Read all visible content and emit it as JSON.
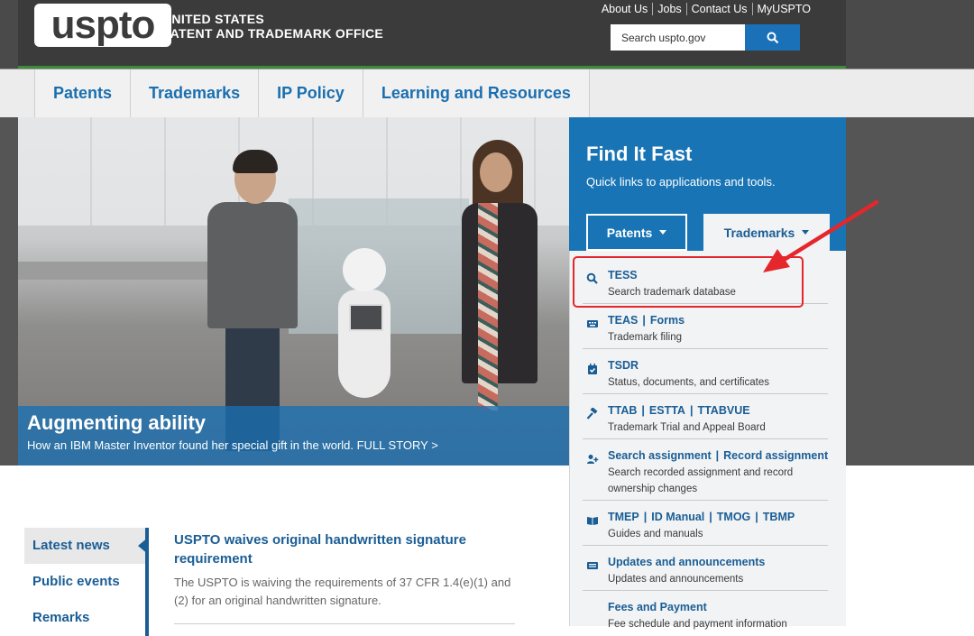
{
  "header": {
    "logo_text": "uspto",
    "org_line1": "UNITED STATES",
    "org_line2": "PATENT AND TRADEMARK OFFICE",
    "util_links": [
      "About Us",
      "Jobs",
      "Contact Us",
      "MyUSPTO"
    ],
    "search_placeholder": "Search uspto.gov"
  },
  "nav": {
    "items": [
      "Patents",
      "Trademarks",
      "IP Policy",
      "Learning and Resources"
    ]
  },
  "hero": {
    "title": "Augmenting ability",
    "subtitle": "How an IBM Master Inventor found her special gift in the world. FULL STORY >"
  },
  "find_it_fast": {
    "title": "Find It Fast",
    "subtitle": "Quick links to applications and tools.",
    "tabs": [
      "Patents",
      "Trademarks"
    ],
    "items": [
      {
        "icon": "search-icon",
        "links": [
          "TESS"
        ],
        "desc": "Search trademark database"
      },
      {
        "icon": "keyboard-icon",
        "links": [
          "TEAS",
          "Forms"
        ],
        "desc": "Trademark filing"
      },
      {
        "icon": "calendar-check-icon",
        "links": [
          "TSDR"
        ],
        "desc": "Status, documents, and certificates"
      },
      {
        "icon": "gavel-icon",
        "links": [
          "TTAB",
          "ESTTA",
          "TTABVUE"
        ],
        "desc": "Trademark Trial and Appeal Board"
      },
      {
        "icon": "user-plus-icon",
        "links": [
          "Search assignment",
          "Record assignment"
        ],
        "desc": "Search recorded assignment and record ownership changes"
      },
      {
        "icon": "book-open-icon",
        "links": [
          "TMEP",
          "ID Manual",
          "TMOG",
          "TBMP"
        ],
        "desc": "Guides and manuals"
      },
      {
        "icon": "newspaper-icon",
        "links": [
          "Updates and announcements"
        ],
        "desc": "Updates and announcements"
      },
      {
        "icon": "none",
        "links": [
          "Fees and Payment"
        ],
        "desc": "Fee schedule and payment information"
      }
    ]
  },
  "news": {
    "tabs": [
      "Latest news",
      "Public events",
      "Remarks"
    ],
    "article_title": "USPTO waives original handwritten signature requirement",
    "article_body": "The USPTO is waiving the requirements of 37 CFR 1.4(e)(1) and (2) for an original handwritten signature."
  },
  "colors": {
    "brand_blue": "#1874b4",
    "link_blue": "#1a5d95",
    "highlight_red": "#e5262c",
    "header_dark": "#3b3b3b"
  }
}
